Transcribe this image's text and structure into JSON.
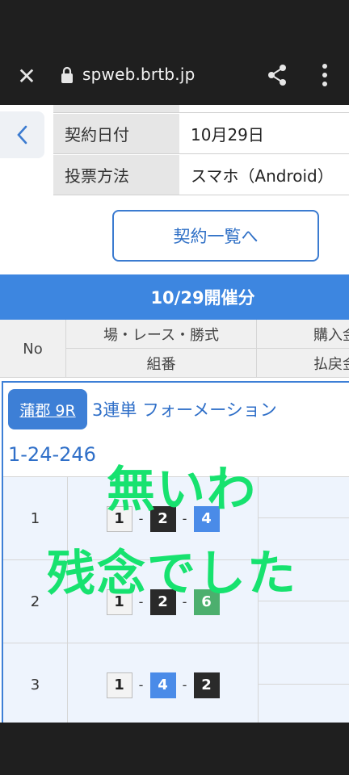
{
  "browser": {
    "url": "spweb.brtb.jp",
    "close_icon": "close-icon",
    "lock_icon": "lock-icon",
    "share_icon": "share-icon",
    "more_icon": "more-vert-icon"
  },
  "contract": {
    "rows": [
      {
        "label": "契約日付",
        "value": "10月29日"
      },
      {
        "label": "投票方法",
        "value": "スマホ（Android）"
      }
    ],
    "list_button": "契約一覧へ"
  },
  "section": {
    "title": "10/29開催分"
  },
  "table_header": {
    "no": "No",
    "col_race": "場・レース・勝式",
    "col_combo": "組番",
    "col_amount": "購入金",
    "col_payout": "払戻金"
  },
  "race": {
    "badge": "蒲郡 9R",
    "type": "3連単 フォーメーション",
    "combo": "1-24-246",
    "bets": [
      {
        "no": "1",
        "boats": [
          "1",
          "2",
          "4"
        ]
      },
      {
        "no": "2",
        "boats": [
          "1",
          "2",
          "6"
        ]
      },
      {
        "no": "3",
        "boats": [
          "1",
          "4",
          "2"
        ]
      }
    ]
  },
  "overlay": {
    "line1": "無いわ",
    "line2": "残念でした"
  },
  "colors": {
    "accent": "#3d86e0",
    "overlay_text": "#17e26f",
    "boat1": "#f3f3f3",
    "boat2": "#2a2a2a",
    "boat4": "#4a8be8",
    "boat6": "#4caf6e"
  }
}
